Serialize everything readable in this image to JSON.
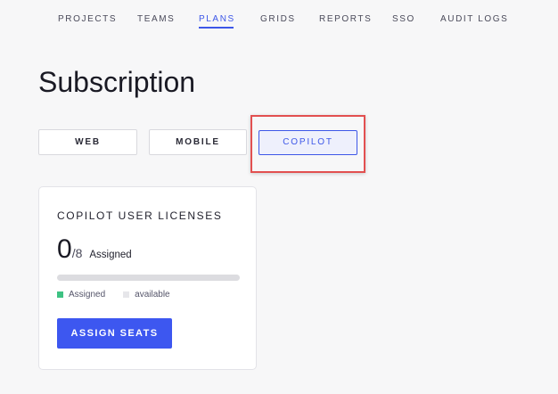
{
  "nav": {
    "items": [
      {
        "label": "PROJECTS"
      },
      {
        "label": "TEAMS"
      },
      {
        "label": "PLANS"
      },
      {
        "label": "GRIDS"
      },
      {
        "label": "REPORTS"
      },
      {
        "label": "SSO"
      },
      {
        "label": "AUDIT LOGS"
      }
    ],
    "active": "PLANS"
  },
  "page": {
    "title": "Subscription"
  },
  "tabs": [
    {
      "label": "WEB"
    },
    {
      "label": "MOBILE"
    },
    {
      "label": "COPILOT"
    }
  ],
  "selected_tab": "COPILOT",
  "license_card": {
    "title": "COPILOT USER LICENSES",
    "assigned_count": "0",
    "total": "/8",
    "assigned_label": "Assigned",
    "assigned_fraction": 0,
    "legend": {
      "assigned": "Assigned",
      "available": "available"
    },
    "assign_button": "ASSIGN SEATS"
  },
  "colors": {
    "accent": "#3d57e8",
    "button": "#3d57f0",
    "assigned": "#3ec283",
    "available": "#e6e6ea",
    "highlight": "#e25050"
  }
}
